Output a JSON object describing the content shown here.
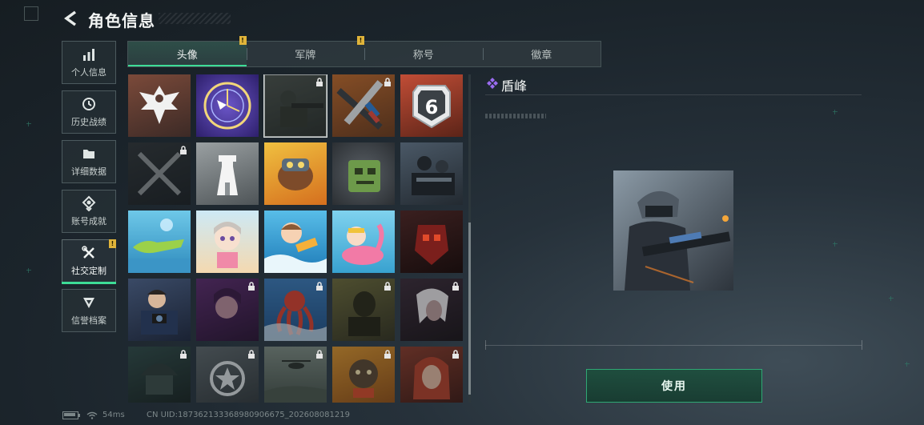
{
  "header": {
    "title": "角色信息"
  },
  "nav": [
    {
      "label": "个人信息",
      "icon": "bar-chart-icon"
    },
    {
      "label": "历史战绩",
      "icon": "history-icon"
    },
    {
      "label": "详细数据",
      "icon": "folder-icon"
    },
    {
      "label": "账号成就",
      "icon": "achievement-icon"
    },
    {
      "label": "社交定制",
      "icon": "wrench-icon",
      "active": true,
      "badge": "!"
    },
    {
      "label": "信誉档案",
      "icon": "shield-icon"
    }
  ],
  "tabs": [
    {
      "label": "头像",
      "active": true,
      "badge": "!"
    },
    {
      "label": "军牌",
      "badge": "!"
    },
    {
      "label": "称号"
    },
    {
      "label": "徽章"
    }
  ],
  "avatars": [
    {
      "icon": "eagle-emblem-avatar",
      "locked": false
    },
    {
      "icon": "clock-bird-avatar",
      "locked": false
    },
    {
      "icon": "soldier-aiming-avatar",
      "locked": true,
      "selected": true
    },
    {
      "icon": "toy-rifles-avatar",
      "locked": true
    },
    {
      "icon": "season-6-badge-avatar",
      "locked": false
    },
    {
      "icon": "crossed-swords-avatar",
      "locked": true
    },
    {
      "icon": "white-tower-avatar",
      "locked": false
    },
    {
      "icon": "cartoon-creature-avatar",
      "locked": false
    },
    {
      "icon": "green-robot-avatar",
      "locked": false
    },
    {
      "icon": "operator-squad-avatar",
      "locked": false
    },
    {
      "icon": "crocodile-float-avatar",
      "locked": false
    },
    {
      "icon": "beach-girl-avatar",
      "locked": false
    },
    {
      "icon": "surfer-kid-avatar",
      "locked": false
    },
    {
      "icon": "flamingo-float-avatar",
      "locked": false
    },
    {
      "icon": "red-mask-avatar",
      "locked": false
    },
    {
      "icon": "photographer-avatar",
      "locked": false
    },
    {
      "icon": "purple-woman-avatar",
      "locked": true
    },
    {
      "icon": "octopus-avatar",
      "locked": true
    },
    {
      "icon": "bald-man-avatar",
      "locked": true
    },
    {
      "icon": "white-hair-avatar",
      "locked": true
    },
    {
      "icon": "helmet-soldier-avatar",
      "locked": true
    },
    {
      "icon": "star-emblem-avatar",
      "locked": true
    },
    {
      "icon": "helicopter-avatar",
      "locked": true
    },
    {
      "icon": "bear-food-avatar",
      "locked": true
    },
    {
      "icon": "red-hair-woman-avatar",
      "locked": true
    }
  ],
  "detail": {
    "name": "盾峰",
    "icon": "purple-diamond-icon"
  },
  "use_button": "使用",
  "status": {
    "ping": "54ms",
    "uid": "CN UID:18736213336898090667­5_202608081219"
  },
  "colors": {
    "accent": "#3ddc97",
    "badge": "#e0b43a"
  }
}
